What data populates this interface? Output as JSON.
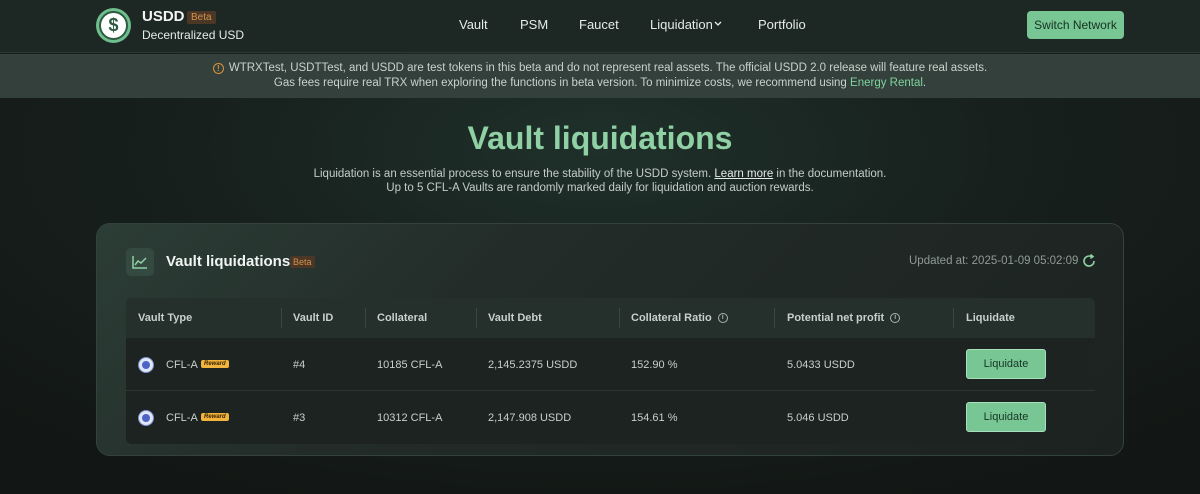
{
  "header": {
    "brand_name": "USDD",
    "brand_beta": "Beta",
    "brand_subtitle": "Decentralized USD",
    "nav": [
      {
        "label": "Vault"
      },
      {
        "label": "PSM"
      },
      {
        "label": "Faucet"
      },
      {
        "label": "Liquidation"
      },
      {
        "label": "Portfolio"
      }
    ],
    "switch_network_label": "Switch Network"
  },
  "notice": {
    "line1": "WTRXTest, USDTTest, and USDD are test tokens in this beta and do not represent real assets. The official USDD 2.0 release will feature real assets.",
    "line2_prefix": "Gas fees require real TRX when exploring the functions in beta version. To minimize costs, we recommend using ",
    "line2_link": "Energy Rental",
    "line2_suffix": "."
  },
  "hero": {
    "title": "Vault liquidations",
    "desc1_prefix": "Liquidation is an essential process to ensure the stability of the USDD system. ",
    "desc1_link": "Learn more",
    "desc1_suffix": " in the documentation.",
    "desc2": "Up to 5 CFL-A Vaults are randomly marked daily for liquidation and auction rewards."
  },
  "card": {
    "title": "Vault liquidations",
    "beta": "Beta",
    "updated": "Updated at: 2025-01-09 05:02:09",
    "columns": [
      "Vault Type",
      "Vault ID",
      "Collateral",
      "Vault Debt",
      "Collateral Ratio",
      "Potential net profit",
      "Liquidate"
    ],
    "rows": [
      {
        "type": "CFL-A",
        "reward": "Reward",
        "id": "#4",
        "collateral": "10185 CFL-A",
        "debt": "2,145.2375 USDD",
        "ratio": "152.90 %",
        "profit": "5.0433 USDD",
        "action": "Liquidate"
      },
      {
        "type": "CFL-A",
        "reward": "Reward",
        "id": "#3",
        "collateral": "10312 CFL-A",
        "debt": "2,147.908 USDD",
        "ratio": "154.61 %",
        "profit": "5.046 USDD",
        "action": "Liquidate"
      }
    ]
  },
  "colors": {
    "accent": "#79c695",
    "title_green": "#8fd1a4",
    "beta_orange": "#d6924a"
  }
}
